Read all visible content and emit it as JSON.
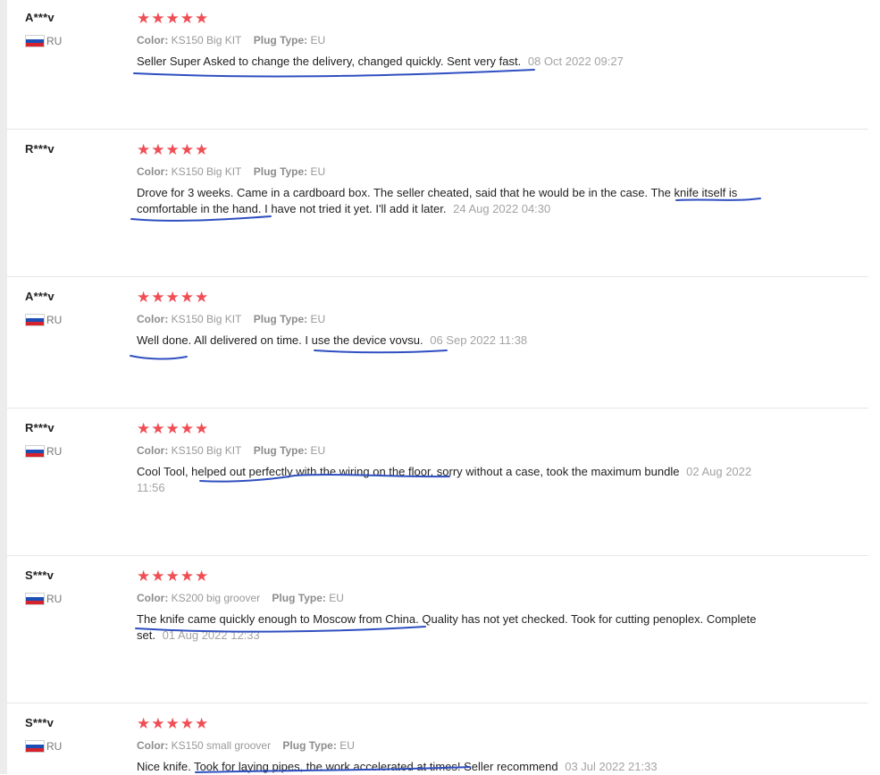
{
  "labels": {
    "color": "Color:",
    "plug_type": "Plug Type:"
  },
  "stars_glyph": "★★★★★",
  "reviews": [
    {
      "name": "A***v",
      "country": "RU",
      "show_country": true,
      "color": "KS150 Big KIT",
      "plug": "EU",
      "text": "Seller Super Asked to change the delivery, changed quickly. Sent very fast.",
      "date": "08 Oct 2022 09:27"
    },
    {
      "name": "R***v",
      "country": "",
      "show_country": false,
      "color": "KS150 Big KIT",
      "plug": "EU",
      "text": "Drove for 3 weeks. Came in a cardboard box. The seller cheated, said that he would be in the case. The knife itself is comfortable in the hand. I have not tried it yet. I'll add it later.",
      "date": "24 Aug 2022 04:30"
    },
    {
      "name": "A***v",
      "country": "RU",
      "show_country": true,
      "color": "KS150 Big KIT",
      "plug": "EU",
      "text": "Well done. All delivered on time. I use the device vovsu.",
      "date": "06 Sep 2022 11:38"
    },
    {
      "name": "R***v",
      "country": "RU",
      "show_country": true,
      "color": "KS150 Big KIT",
      "plug": "EU",
      "text": "Cool Tool, helped out perfectly with the wiring on the floor, sorry without a case, took the maximum bundle",
      "date": "02 Aug 2022 11:56"
    },
    {
      "name": "S***v",
      "country": "RU",
      "show_country": true,
      "color": "KS200 big groover",
      "plug": "EU",
      "text": "The knife came quickly enough to Moscow from China. Quality has not yet checked. Took for cutting penoplex. Complete set.",
      "date": "01 Aug 2022 12:33"
    },
    {
      "name": "S***v",
      "country": "RU",
      "show_country": true,
      "color": "KS150 small groover",
      "plug": "EU",
      "text": "Nice knife. Took for laying pipes, the work accelerated at times! Seller recommend",
      "date": "03 Jul 2022 21:33"
    }
  ],
  "colors": {
    "stars": "#ef4e55",
    "annotation_ink": "#2f4fc0",
    "separator": "#e6e6e6"
  }
}
